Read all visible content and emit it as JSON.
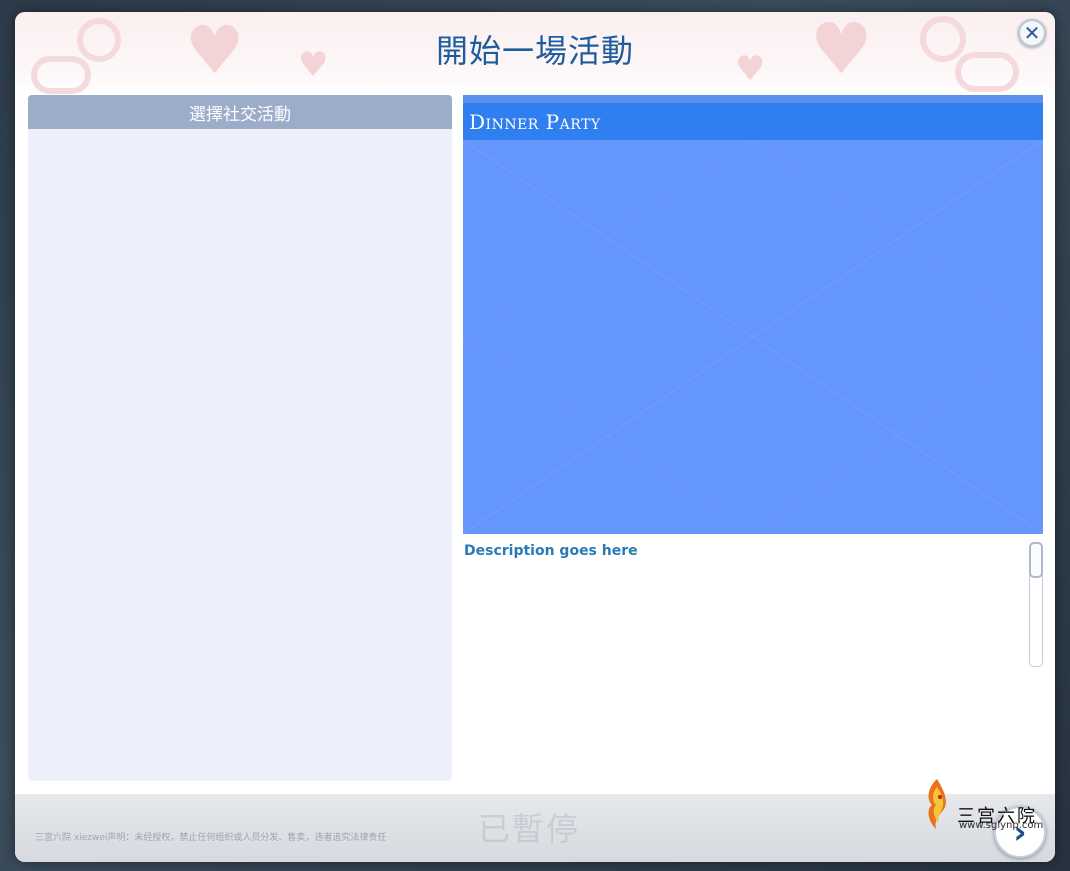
{
  "dialog": {
    "title": "開始一場活動",
    "close_icon": "close-icon"
  },
  "left_panel": {
    "header": "選擇社交活動",
    "items": []
  },
  "activity": {
    "name": "Dinner Party",
    "description": "Description goes here"
  },
  "footer": {
    "status": "已暫停",
    "disclaimer": "三宮六院 xiezwei声明：未经授权，禁止任何组织或人员分发、售卖，违者追究法律责任",
    "next_icon": "chevron-right-icon"
  },
  "watermark": {
    "logo_text": "三宫六院",
    "logo_url": "www.sglynp.com"
  },
  "colors": {
    "title": "#1e5c9e",
    "left_header": "#9badc9",
    "left_body": "#edf0fa",
    "card_title_bar": "#2f7ff0",
    "card_body": "#6496fb",
    "description": "#2a7ab6"
  }
}
